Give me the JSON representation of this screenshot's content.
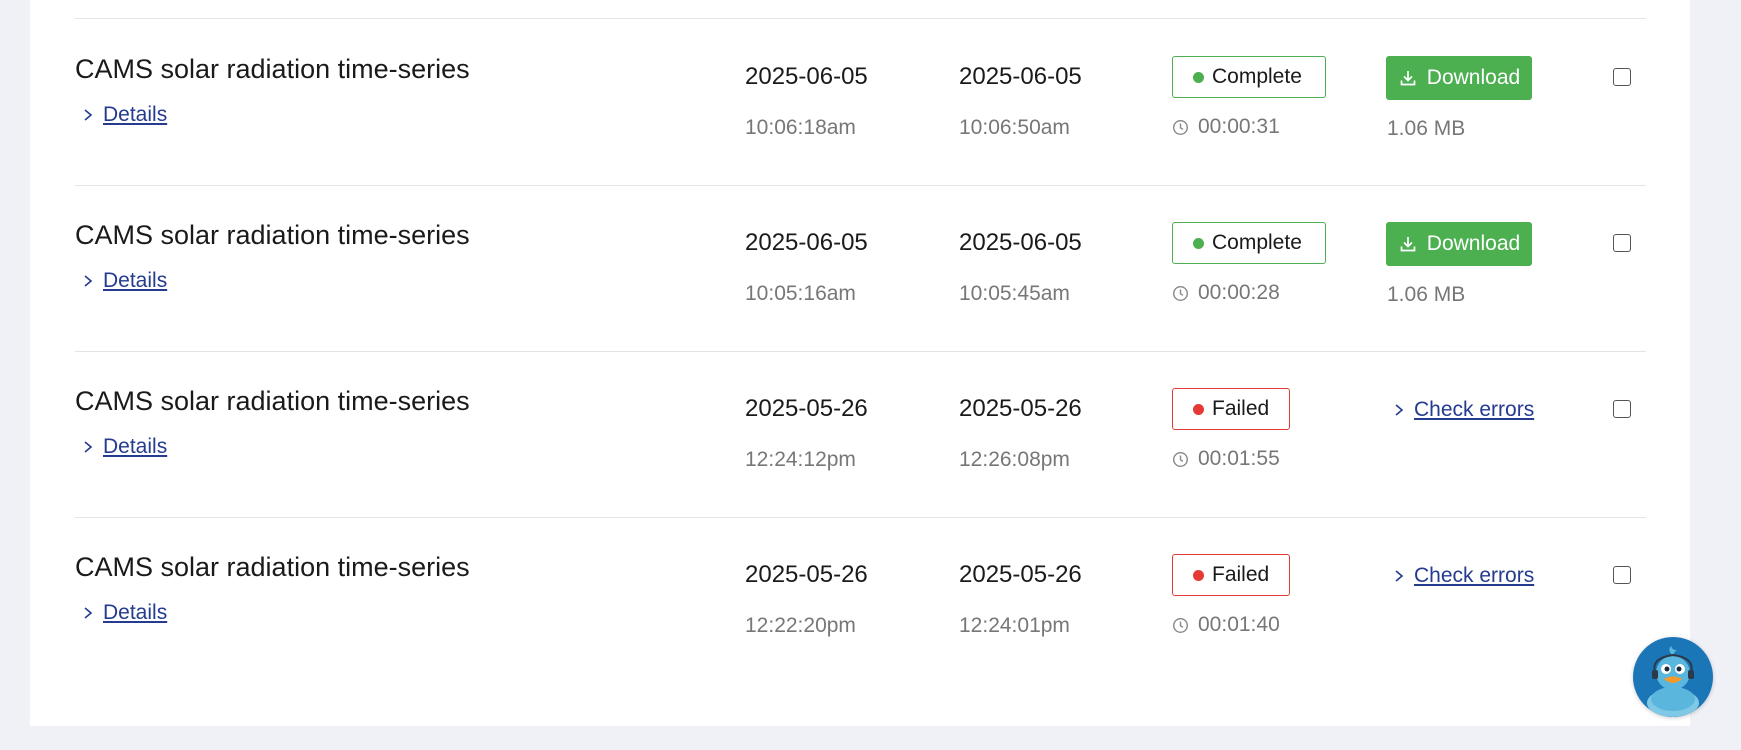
{
  "rows": [
    {
      "title": "CAMS solar radiation time-series",
      "details_label": "Details",
      "start_date": "2025-06-05",
      "start_time": "10:06:18am",
      "end_date": "2025-06-05",
      "end_time": "10:06:50am",
      "status": "Complete",
      "duration": "00:00:31",
      "action_label": "Download",
      "size": "1.06 MB"
    },
    {
      "title": "CAMS solar radiation time-series",
      "details_label": "Details",
      "start_date": "2025-06-05",
      "start_time": "10:05:16am",
      "end_date": "2025-06-05",
      "end_time": "10:05:45am",
      "status": "Complete",
      "duration": "00:00:28",
      "action_label": "Download",
      "size": "1.06 MB"
    },
    {
      "title": "CAMS solar radiation time-series",
      "details_label": "Details",
      "start_date": "2025-05-26",
      "start_time": "12:24:12pm",
      "end_date": "2025-05-26",
      "end_time": "12:26:08pm",
      "status": "Failed",
      "duration": "00:01:55",
      "action_label": "Check errors"
    },
    {
      "title": "CAMS solar radiation time-series",
      "details_label": "Details",
      "start_date": "2025-05-26",
      "start_time": "12:22:20pm",
      "end_date": "2025-05-26",
      "end_time": "12:24:01pm",
      "status": "Failed",
      "duration": "00:01:40",
      "action_label": "Check errors"
    }
  ],
  "colors": {
    "complete": "#4caf50",
    "failed": "#e53935",
    "download_button": "#4caf50",
    "link": "#243b8f",
    "chat_widget": "#1b76b8"
  },
  "icons": {
    "details": "chevron-right-icon",
    "duration": "clock-icon",
    "download": "download-icon",
    "check_errors": "chevron-right-icon",
    "chat": "duck-mascot-icon"
  }
}
